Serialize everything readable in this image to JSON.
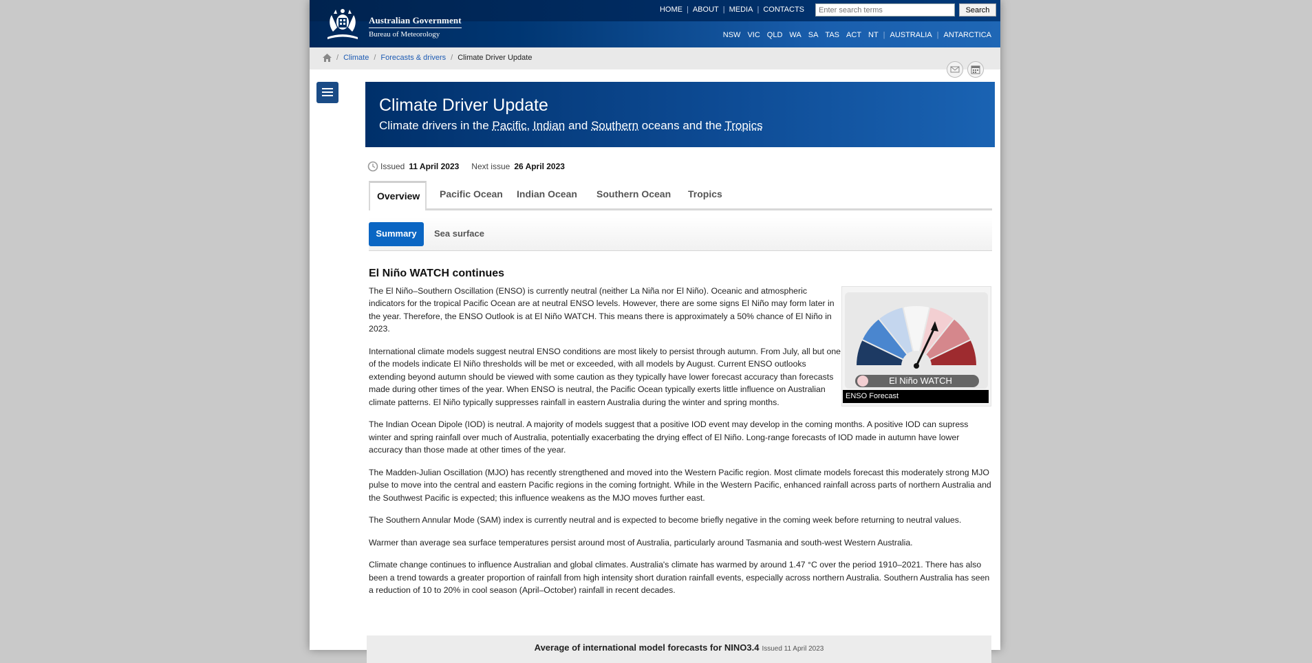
{
  "header": {
    "gov_name": "Australian Government",
    "agency": "Bureau of Meteorology",
    "top_links": [
      "HOME",
      "ABOUT",
      "MEDIA",
      "CONTACTS"
    ],
    "search_placeholder": "Enter search terms",
    "search_button": "Search",
    "states": [
      "NSW",
      "VIC",
      "QLD",
      "WA",
      "SA",
      "TAS",
      "ACT",
      "NT",
      "AUSTRALIA",
      "ANTARCTICA"
    ]
  },
  "breadcrumb": {
    "climate": "Climate",
    "forecasts": "Forecasts & drivers",
    "current": "Climate Driver Update"
  },
  "title": {
    "main": "Climate Driver Update",
    "sub_prefix": "Climate drivers in the ",
    "pacific": "Pacific",
    "comma": ", ",
    "indian": "Indian",
    "and": " and ",
    "southern": "Southern",
    "oceans_and_the": " oceans and the ",
    "tropics": "Tropics"
  },
  "issue": {
    "issued_label": "Issued",
    "issued_date": "11 April 2023",
    "next_label": "Next issue",
    "next_date": "26 April 2023"
  },
  "tabs": [
    "Overview",
    "Pacific Ocean",
    "Indian Ocean",
    "Southern Ocean",
    "Tropics"
  ],
  "subtabs": {
    "summary": "Summary",
    "sea": "Sea surface"
  },
  "article": {
    "heading": "El Niño WATCH continues",
    "p1": "The El Niño–Southern Oscillation (ENSO) is currently neutral (neither La Niña nor El Niño). Oceanic and atmospheric indicators for the tropical Pacific Ocean are at neutral ENSO levels. However, there are some signs El Niño may form later in the year. Therefore, the ENSO Outlook is at El Niño WATCH. This means there is approximately a 50% chance of El Niño in 2023.",
    "p2": "International climate models suggest neutral ENSO conditions are most likely to persist through autumn. From July, all but one of the models indicate El Niño thresholds will be met or exceeded, with all models by August. Current ENSO outlooks extending beyond autumn should be viewed with some caution as they typically have lower forecast accuracy than forecasts made during other times of the year. When ENSO is neutral, the Pacific Ocean typically exerts little influence on Australian climate patterns. El Niño typically suppresses rainfall in eastern Australia during the winter and spring months.",
    "p3": "The Indian Ocean Dipole (IOD) is neutral. A majority of models suggest that a positive IOD event may develop in the coming months. A positive IOD can supress winter and spring rainfall over much of Australia, potentially exacerbating the drying effect of El Niño. Long-range forecasts of IOD made in autumn have lower accuracy than those made at other times of the year.",
    "p4": "The Madden-Julian Oscillation (MJO) has recently strengthened and moved into the Western Pacific region. Most climate models forecast this moderately strong MJO pulse to move into the central and eastern Pacific regions in the coming fortnight. While in the Western Pacific, enhanced rainfall across parts of northern Australia and the Southwest Pacific is expected; this influence weakens as the MJO moves further east.",
    "p5": "The Southern Annular Mode (SAM) index is currently neutral and is expected to become briefly negative in the coming week before returning to neutral values.",
    "p6": "Warmer than average sea surface temperatures persist around most of Australia, particularly around Tasmania and south-west Western Australia.",
    "p7": "Climate change continues to influence Australian and global climates. Australia's climate has warmed by around 1.47 °C over the period 1910–2021. There has also been a trend towards a greater proportion of rainfall from high intensity short duration rainfall events, especially across northern Australia. Southern Australia has seen a reduction of 10 to 20% in cool season (April–October) rainfall in recent decades."
  },
  "gauge": {
    "status": "El Niño WATCH",
    "caption": "ENSO Forecast",
    "segment_colors": [
      "#1d3a63",
      "#4a86cf",
      "#c4d6ee",
      "#f6f6f6",
      "#f3cfd2",
      "#d5878c",
      "#9e2b2f"
    ]
  },
  "model_strip": {
    "title": "Average of international model forecasts for NINO3.4",
    "issued": "Issued 11 April 2023"
  },
  "icons": {
    "home": "home-icon",
    "mail": "mail-icon",
    "calendar": "calendar-icon",
    "menu": "menu-icon",
    "clock": "clock-icon"
  }
}
